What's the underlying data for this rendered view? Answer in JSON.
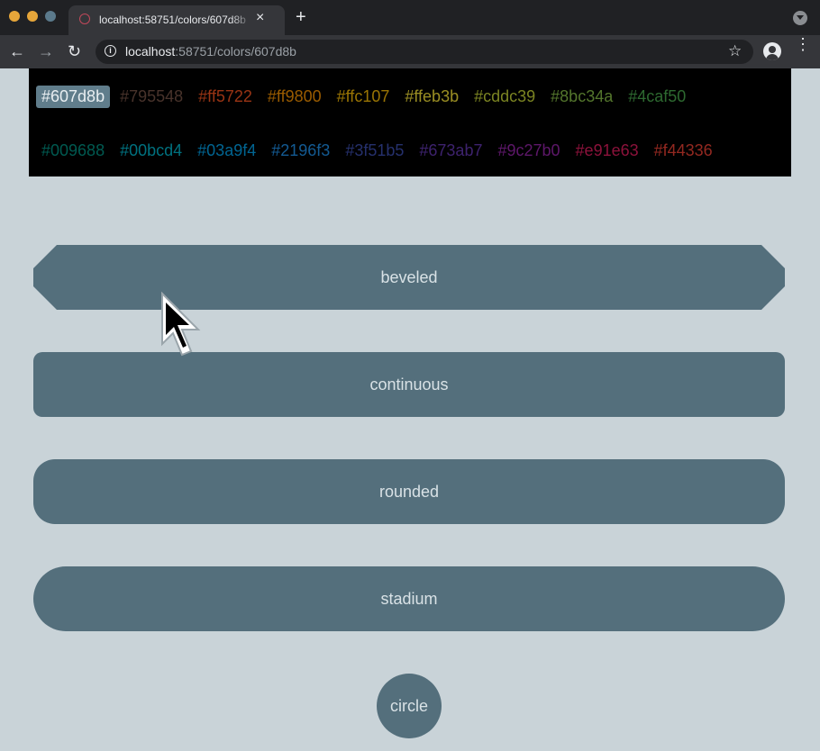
{
  "browser": {
    "tab_title": "localhost:58751/colors/607d8b",
    "url_host": "localhost",
    "url_rest": ":58751/colors/607d8b",
    "new_tab_glyph": "+",
    "close_glyph": "×",
    "back_glyph": "←",
    "forward_glyph": "→",
    "reload_glyph": "↻",
    "star_glyph": "☆",
    "info_glyph": "i",
    "menu_glyph": "⋮",
    "icons": [
      "favicon-icon",
      "close-icon",
      "new-tab-icon",
      "tab-search-icon",
      "back-icon",
      "forward-icon",
      "reload-icon",
      "info-icon",
      "bookmark-star-icon",
      "profile-icon",
      "menu-icon"
    ]
  },
  "colors": {
    "selected": "#607d8b",
    "row1": [
      {
        "label": "#607d8b",
        "color": "#e8eef1"
      },
      {
        "label": "#795548",
        "color": "#795548"
      },
      {
        "label": "#ff5722",
        "color": "#ff5722"
      },
      {
        "label": "#ff9800",
        "color": "#ff9800"
      },
      {
        "label": "#ffc107",
        "color": "#ffc107"
      },
      {
        "label": "#ffeb3b",
        "color": "#ffeb3b"
      },
      {
        "label": "#cddc39",
        "color": "#cddc39"
      },
      {
        "label": "#8bc34a",
        "color": "#8bc34a"
      },
      {
        "label": "#4caf50",
        "color": "#4caf50"
      }
    ],
    "row2": [
      {
        "label": "#009688",
        "color": "#009688"
      },
      {
        "label": "#00bcd4",
        "color": "#00bcd4"
      },
      {
        "label": "#03a9f4",
        "color": "#03a9f4"
      },
      {
        "label": "#2196f3",
        "color": "#2196f3"
      },
      {
        "label": "#3f51b5",
        "color": "#3f51b5"
      },
      {
        "label": "#673ab7",
        "color": "#673ab7"
      },
      {
        "label": "#9c27b0",
        "color": "#9c27b0"
      },
      {
        "label": "#e91e63",
        "color": "#e91e63"
      },
      {
        "label": "#f44336",
        "color": "#f44336"
      }
    ]
  },
  "shapes": {
    "beveled": "beveled",
    "continuous": "continuous",
    "rounded": "rounded",
    "stadium": "stadium",
    "circle": "circle"
  },
  "theme": {
    "page_bg": "#c9d3d8",
    "button_bg": "#546f7c",
    "button_text": "#d9e2e6"
  }
}
